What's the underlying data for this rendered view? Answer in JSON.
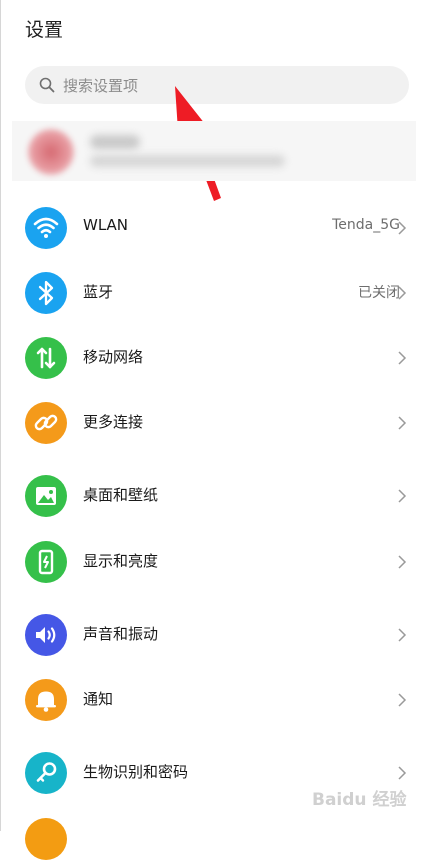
{
  "header": {
    "title": "设置"
  },
  "search": {
    "placeholder": "搜索设置项"
  },
  "settings": [
    {
      "label": "WLAN",
      "value": "Tenda_5G",
      "icon": "wifi-icon",
      "color": "#1aa3f0"
    },
    {
      "label": "蓝牙",
      "value": "已关闭",
      "icon": "bluetooth-icon",
      "color": "#1aa3f0"
    },
    {
      "label": "移动网络",
      "value": "",
      "icon": "mobile-data-icon",
      "color": "#35c04a"
    },
    {
      "label": "更多连接",
      "value": "",
      "icon": "link-icon",
      "color": "#f49a1a"
    },
    {
      "label": "桌面和壁纸",
      "value": "",
      "icon": "image-icon",
      "color": "#35c04a"
    },
    {
      "label": "显示和亮度",
      "value": "",
      "icon": "display-brightness-icon",
      "color": "#35c04a"
    },
    {
      "label": "声音和振动",
      "value": "",
      "icon": "speaker-icon",
      "color": "#4557e6"
    },
    {
      "label": "通知",
      "value": "",
      "icon": "bell-icon",
      "color": "#f49a1a"
    },
    {
      "label": "生物识别和密码",
      "value": "",
      "icon": "key-icon",
      "color": "#17b4c9"
    }
  ],
  "watermark": {
    "text": "Baidu 经验"
  }
}
